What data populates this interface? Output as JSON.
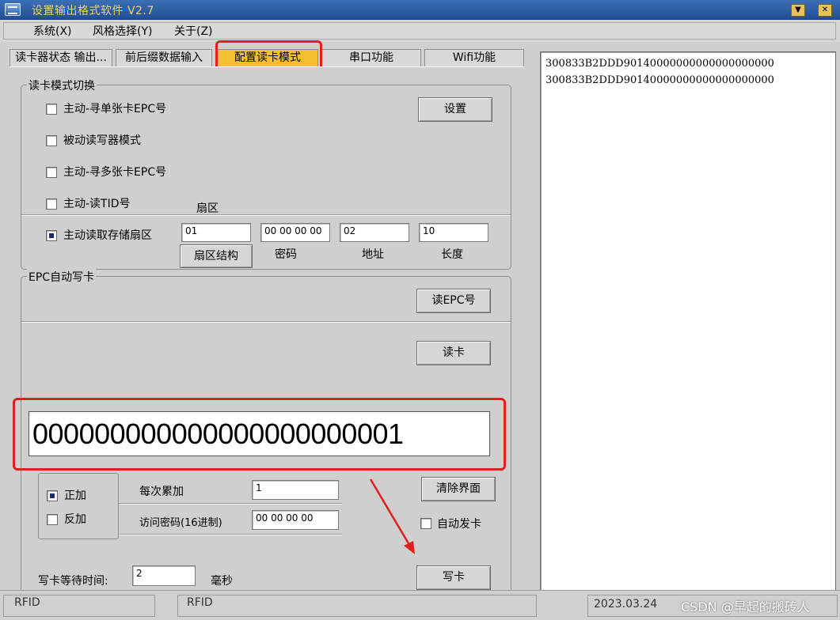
{
  "window": {
    "title": "设置输出格式软件 V2.7"
  },
  "menu": [
    {
      "label": "系统(X)"
    },
    {
      "label": "风格选择(Y)"
    },
    {
      "label": "关于(Z)"
    }
  ],
  "tabs": [
    {
      "label": "读卡器状态 输出..."
    },
    {
      "label": "前后缀数据输入"
    },
    {
      "label": "配置读卡模式"
    },
    {
      "label": "串口功能"
    },
    {
      "label": "Wifi功能"
    }
  ],
  "read_mode": {
    "group_label": "读卡模式切换",
    "options": [
      {
        "label": "主动-寻单张卡EPC号"
      },
      {
        "label": "被动读写器模式"
      },
      {
        "label": "主动-寻多张卡EPC号"
      },
      {
        "label": "主动-读TID号"
      },
      {
        "label": "主动读取存储扇区"
      }
    ],
    "set_button": "设置",
    "sector_label": "扇区",
    "sector_value": "01",
    "password_value": "00 00 00 00",
    "address_value": "02",
    "length_value": "10",
    "sector_struct_button": "扇区结构",
    "password_label": "密码",
    "address_label": "地址",
    "length_label": "长度"
  },
  "epc_write": {
    "group_label": "EPC自动写卡",
    "read_epc_button": "读EPC号",
    "read_card_button": "读卡",
    "display_value": "000000000000000000000001",
    "increment_positive": "正加",
    "increment_negative": "反加",
    "step_label": "每次累加",
    "step_value": "1",
    "access_password_label": "访问密码(16进制)",
    "access_password_value": "00 00 00 00",
    "clear_button": "清除界面",
    "auto_issue_label": "自动发卡",
    "wait_label": "写卡等待时间:",
    "wait_value": "2",
    "wait_unit": "毫秒",
    "write_button": "写卡"
  },
  "log": {
    "lines": [
      "300833B2DDD90140000000000000000000",
      "300833B2DDD90140000000000000000000"
    ]
  },
  "status": {
    "seg1": "RFID",
    "seg2": "RFID",
    "date": "2023.03.24",
    "watermark": "CSDN @早起的搬砖人"
  }
}
